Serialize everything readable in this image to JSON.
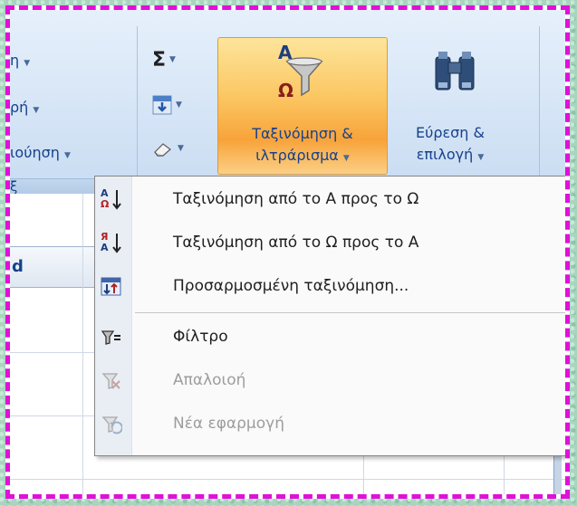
{
  "ribbon": {
    "left_items": [
      "η",
      "ρή",
      "ιούηση"
    ],
    "group_label": "ξ",
    "sort_filter_label_1": "Ταξινόμηση &",
    "sort_filter_label_2": "ιλτράρισμα",
    "find_label_1": "Εύρεση &",
    "find_label_2": "επιλογή",
    "sigma_glyph": "Σ",
    "sort_icon_top": "A",
    "sort_icon_bottom": "Ω"
  },
  "sheet": {
    "col_letter": "d"
  },
  "menu": {
    "items": [
      {
        "icon": "sort-az-icon",
        "label": "Ταξινόμηση από το Α προς το Ω",
        "enabled": true
      },
      {
        "icon": "sort-za-icon",
        "label": "Ταξινόμηση από το Ω προς το Α",
        "enabled": true
      },
      {
        "icon": "custom-sort-icon",
        "label": "Προσαρμοσμένη ταξινόμηση...",
        "enabled": true
      },
      {
        "icon": "filter-icon",
        "label": "Φίλτρο",
        "enabled": true
      },
      {
        "icon": "clear-filter-icon",
        "label": "Απαλοιοή",
        "enabled": false
      },
      {
        "icon": "reapply-icon",
        "label": "Νέα εφαρμογή",
        "enabled": false
      }
    ],
    "az_icon_top": "A",
    "az_icon_bottom": "Ω",
    "za_icon_top": "Я",
    "za_icon_bottom": "A"
  },
  "colors": {
    "accent": "#e010d8",
    "ribbon_text": "#15428b",
    "highlight_orange": "#fbc560"
  }
}
